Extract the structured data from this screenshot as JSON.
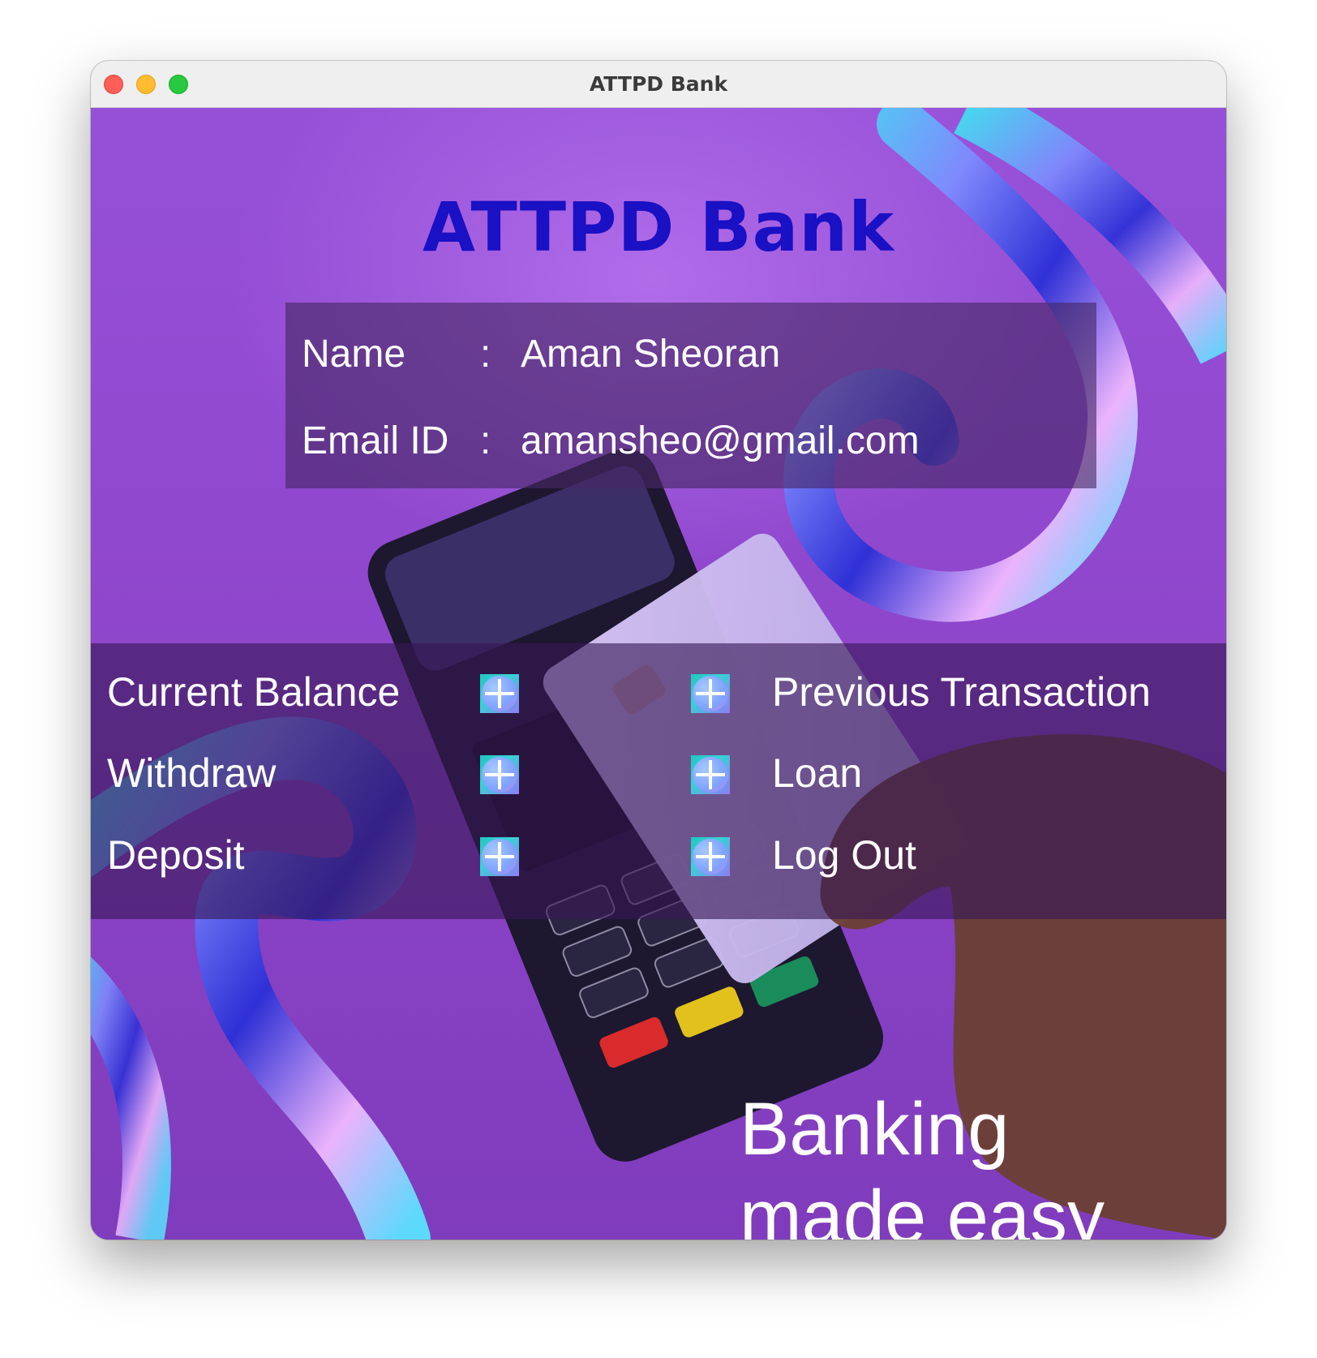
{
  "window": {
    "title": "ATTPD Bank"
  },
  "app": {
    "title": "ATTPD Bank"
  },
  "profile": {
    "name_label": "Name",
    "name_value": "Aman Sheoran",
    "email_label": "Email ID",
    "email_value": "amansheo@gmail.com",
    "separator": ":"
  },
  "menu": {
    "current_balance": "Current Balance",
    "withdraw": "Withdraw",
    "deposit": "Deposit",
    "previous_transaction": "Previous Transaction",
    "loan": "Loan",
    "log_out": "Log Out"
  },
  "tagline": {
    "line1": "Banking",
    "line2": "made easy"
  },
  "colors": {
    "title": "#1a10c4",
    "background": "#8d44c9",
    "button": "#39d1d6"
  }
}
